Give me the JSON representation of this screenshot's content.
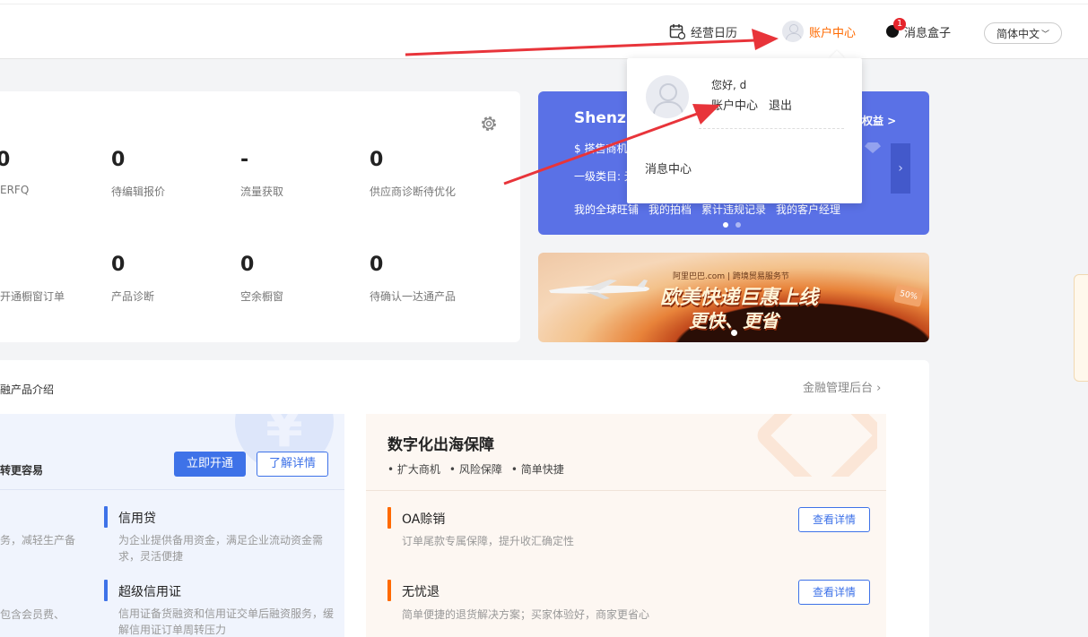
{
  "header": {
    "calendar_label": "经营日历",
    "account_label": "账户中心",
    "message_label": "消息盒子",
    "message_badge": "1",
    "language_label": "简体中文"
  },
  "stats": {
    "row1": [
      {
        "value": "0",
        "label": "ERFQ"
      },
      {
        "value": "0",
        "label": "待编辑报价"
      },
      {
        "value": "-",
        "label": "流量获取"
      },
      {
        "value": "0",
        "label": "供应商诊断待优化"
      }
    ],
    "row2": [
      {
        "value": "",
        "label": "开通橱窗订单"
      },
      {
        "value": "0",
        "label": "产品诊断"
      },
      {
        "value": "0",
        "label": "空余橱窗"
      },
      {
        "value": "0",
        "label": "待确认一达通产品"
      }
    ]
  },
  "blue_banner": {
    "title": "Shenzh",
    "rights": "权益 >",
    "category_line": "一级类目: 无",
    "badge_line": "$  搭售商机",
    "links": [
      "我的全球旺铺",
      "我的拍档",
      "累计违规记录",
      "我的客户经理"
    ],
    "slide_index": 1,
    "slide_count": 2
  },
  "promo": {
    "top_text": "阿里巴巴.com | 跨境贸易服务节",
    "line1": "欧美快递巨惠上线",
    "line2": "更快、更省",
    "tag": "50%"
  },
  "finance": {
    "title": "融产品介绍",
    "admin_link": "金融管理后台",
    "tagline": "转更容易",
    "open_button": "立即开通",
    "more_button": "了解详情",
    "left_products": [
      {
        "name": "",
        "desc": "务，减轻生产备"
      },
      {
        "name": "信用贷",
        "desc": "为企业提供备用资金，满足企业流动资金需求，灵活便捷"
      },
      {
        "name": "",
        "desc": "包含会员费、"
      },
      {
        "name": "超级信用证",
        "desc": "信用证备货融资和信用证交单后融资服务，缓解信用证订单周转压力"
      }
    ],
    "digital_title": "数字化出海保障",
    "digital_tags": [
      "扩大商机",
      "风险保障",
      "简单快捷"
    ],
    "right_products": [
      {
        "name": "OA赊销",
        "desc": "订单尾款专属保障，提升收汇确定性",
        "button": "查看详情"
      },
      {
        "name": "无忧退",
        "desc": "简单便捷的退货解决方案；买家体验好，商家更省心",
        "button": "查看详情"
      }
    ]
  },
  "popup": {
    "greeting": "您好, d",
    "account_link": "账户中心",
    "logout_link": "退出",
    "message_center": "消息中心"
  },
  "colors": {
    "accent_orange": "#ff6a00",
    "primary_blue": "#3e72e8",
    "banner_blue": "#5a71e6",
    "annotation_red": "#e8343a"
  }
}
